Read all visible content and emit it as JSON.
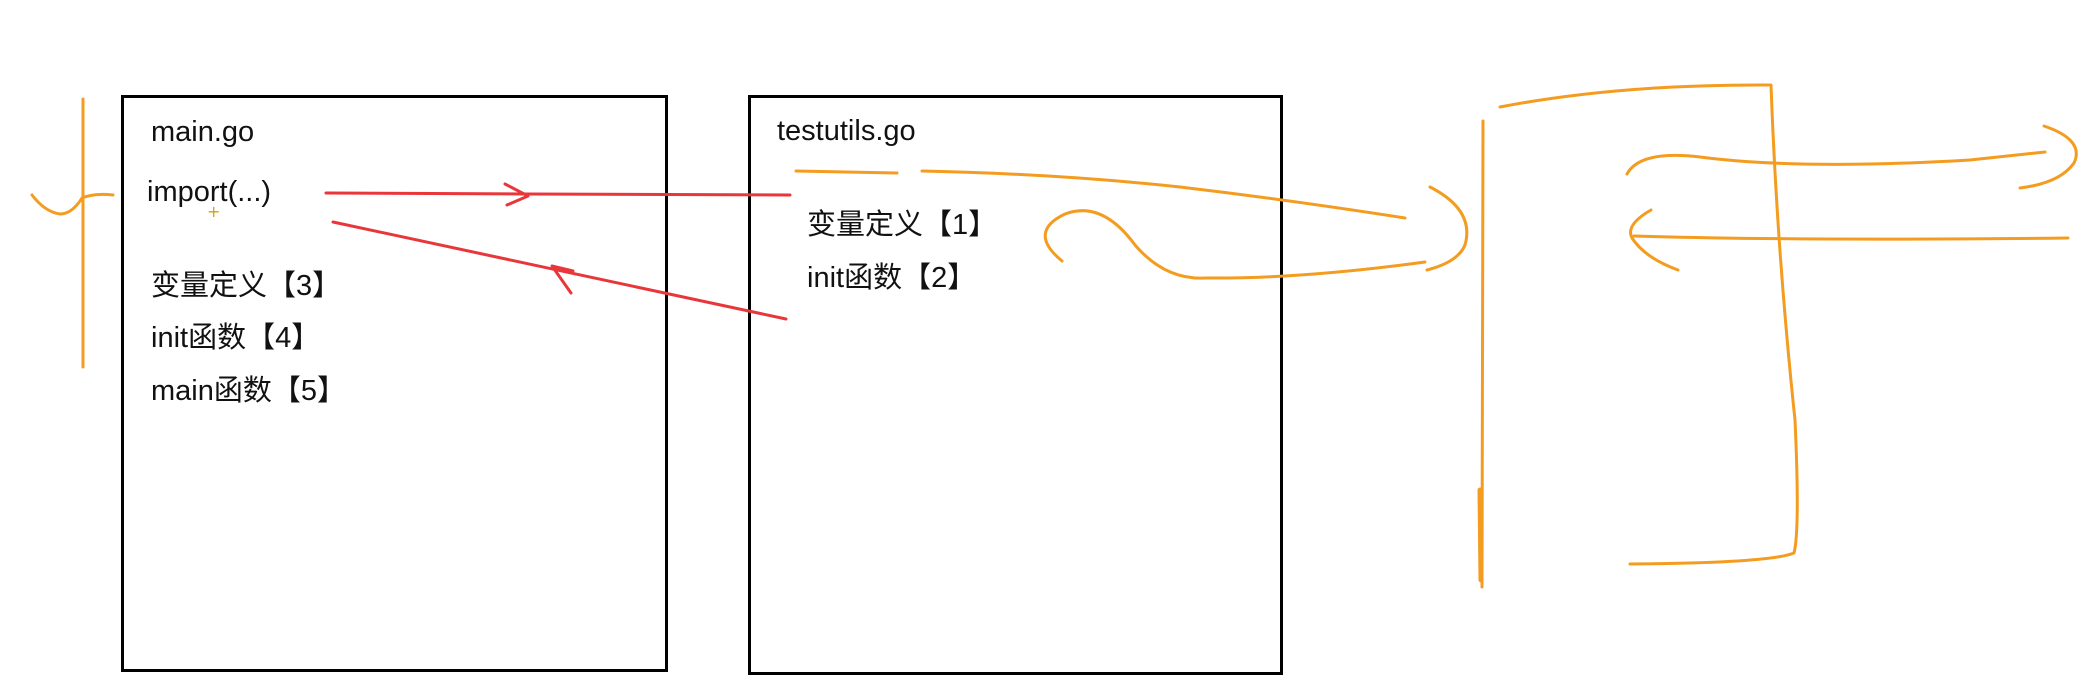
{
  "main_file": {
    "title": "main.go",
    "import": "import(...)",
    "lines": [
      "变量定义【3】",
      "init函数【4】",
      "main函数【5】"
    ]
  },
  "util_file": {
    "title": "testutils.go",
    "lines": [
      "变量定义【1】",
      "init函数【2】"
    ]
  },
  "colors": {
    "arrow": "#e8363a",
    "orange_ink": "#f39c1f",
    "box_border": "#000000"
  }
}
